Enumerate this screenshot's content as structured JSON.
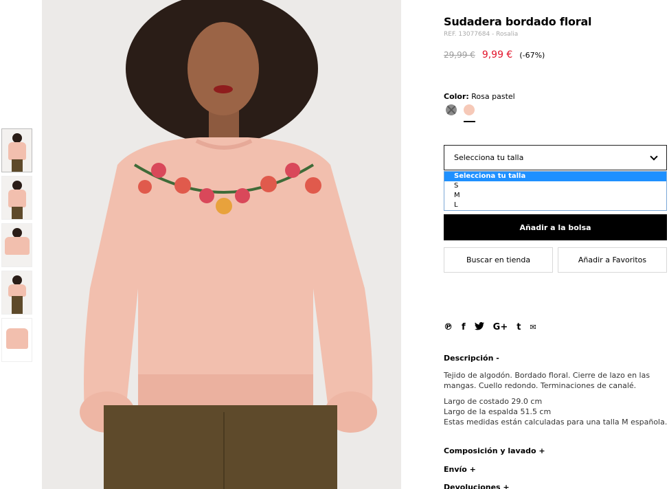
{
  "product": {
    "title": "Sudadera bordado floral",
    "ref": "REF. 13077684 - Rosalia",
    "old_price": "29,99 €",
    "new_price": "9,99 €",
    "discount": "(-67%)"
  },
  "color": {
    "label": "Color:",
    "value": "Rosa pastel",
    "swatches": [
      {
        "name": "grey-unavailable",
        "color": "#8c8c8c"
      },
      {
        "name": "rosa-pastel",
        "color": "#f6c9b8"
      }
    ]
  },
  "size": {
    "placeholder": "Selecciona tu talla",
    "options": [
      "Selecciona tu talla",
      "S",
      "M",
      "L"
    ],
    "selected_index": 0
  },
  "actions": {
    "add_to_bag": "Añadir a la bolsa",
    "find_in_store": "Buscar en tienda",
    "add_favorites": "Añadir a Favoritos"
  },
  "social": [
    "pinterest-icon",
    "facebook-icon",
    "twitter-icon",
    "google-plus-icon",
    "tumblr-icon",
    "email-icon"
  ],
  "social_glyphs": {
    "pinterest": "℗",
    "facebook": "f",
    "twitter": "🐦",
    "gplus": "G+",
    "tumblr": "t",
    "email": "✉"
  },
  "details": {
    "description_title": "Descripción -",
    "description_lines": [
      "Tejido de algodón. Bordado floral. Cierre de lazo en las mangas. Cuello redondo. Terminaciones de canalé.",
      "Largo de costado 29.0 cm",
      "Largo de la espalda 51.5 cm",
      "Estas medidas están calculadas para una talla M española."
    ],
    "composition_title": "Composición y lavado +",
    "shipping_title": "Envío +",
    "returns_title": "Devoluciones +"
  },
  "thumbnails_count": 5,
  "colors": {
    "accent_price": "#e2142b",
    "select_highlight": "#1e90ff",
    "sweater": "#f2bfae"
  }
}
